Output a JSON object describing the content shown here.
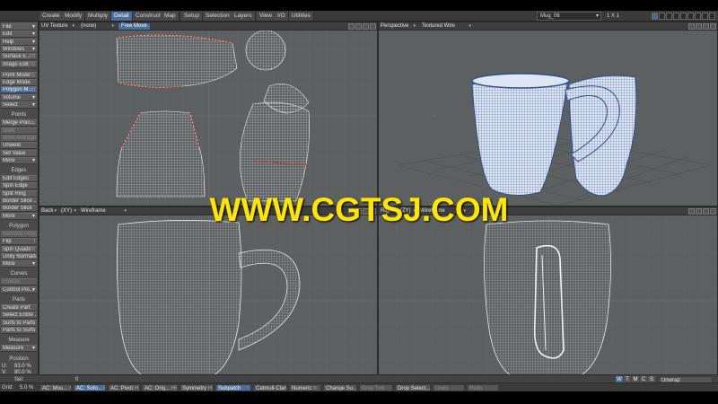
{
  "menu": {
    "tabs": [
      "Create",
      "Modify",
      "Multiply",
      "Detail",
      "Construct",
      "Map",
      "Setup",
      "Selection",
      "Layers",
      "View",
      "I/O",
      "Utilities"
    ],
    "active_tab": "Detail",
    "object_name": "Mug_06",
    "layer_label": "1 X 1"
  },
  "toolbar": {
    "top_buttons": [
      {
        "label": "File",
        "dropdown": true
      },
      {
        "label": "Edit",
        "dropdown": true
      },
      {
        "label": "Help",
        "dropdown": true
      },
      {
        "label": "Windows",
        "dropdown": true
      },
      {
        "label": "Surface E...",
        "key": "F5"
      },
      {
        "label": "Image Edit",
        "key": "F6"
      }
    ],
    "mode_buttons": [
      {
        "label": "Point Mode",
        "key": "^G"
      },
      {
        "label": "Edge Mode",
        "key": ""
      },
      {
        "label": "Polygon M...",
        "key": "^H",
        "selected": true
      },
      {
        "label": "Volume",
        "dropdown": true
      },
      {
        "label": "Select",
        "dropdown": true
      }
    ],
    "sections": [
      {
        "title": "Points",
        "items": [
          {
            "label": "Merge Poin...",
            "key": "m"
          },
          {
            "label": "Weld",
            "dim": true
          },
          {
            "label": "Weld Average",
            "dim": true
          },
          {
            "label": "Unweld"
          },
          {
            "label": "Set Value"
          },
          {
            "label": "More",
            "dropdown": true
          }
        ]
      },
      {
        "title": "Edges",
        "items": [
          {
            "label": "Edit Edges"
          },
          {
            "label": "Spin Edge"
          },
          {
            "label": "Split Ring"
          },
          {
            "label": "Border Slice ..."
          },
          {
            "label": "Border Slice"
          },
          {
            "label": "More",
            "dropdown": true
          }
        ]
      },
      {
        "title": "Polygon",
        "items": [
          {
            "label": "Remove Polyg...",
            "dim": true
          },
          {
            "label": "Flip",
            "key": "f"
          },
          {
            "label": "Spin Quads",
            "key": "^K"
          },
          {
            "label": "Unify Normals"
          },
          {
            "label": "More",
            "dropdown": true
          }
        ]
      },
      {
        "title": "Curves",
        "items": [
          {
            "label": "Freeze",
            "dim": true
          },
          {
            "label": "Control Poi...",
            "dropdown": true
          }
        ]
      },
      {
        "title": "Parts",
        "items": [
          {
            "label": "Create Part"
          },
          {
            "label": "Select Entire ..."
          },
          {
            "label": "Surfs to Parts"
          },
          {
            "label": "Parts to Surfs"
          }
        ]
      },
      {
        "title": "Measure",
        "items": [
          {
            "label": "Measure",
            "dropdown": true
          }
        ]
      }
    ],
    "position": {
      "title": "Position",
      "u_label": "U:",
      "u_value": "83.0 %",
      "v_label": "V:",
      "v_value": "80.0 %"
    }
  },
  "viewports": {
    "top_left": {
      "view": "UV Texture",
      "map": "(none)",
      "mode": "Free Move"
    },
    "top_right": {
      "view": "Perspective",
      "render": "Textured Wire"
    },
    "bottom_left": {
      "view": "Back",
      "axes": "(XY)",
      "render": "Wireframe"
    },
    "bottom_right": {
      "view": "Right",
      "axes": "(ZY)",
      "render": "Wireframe"
    }
  },
  "watermark": "WWW.CGTSJ.COM",
  "status": {
    "sel_label": "Sel:",
    "sel_value": "0",
    "wtmcs": [
      "W",
      "T",
      "M",
      "C",
      "S"
    ],
    "wtmcs_active": "W",
    "unwrap": "Unwrap",
    "grid_label": "Grid:",
    "grid_value": "5.0 %",
    "bottom_buttons": [
      {
        "label": "AC: Mou...",
        "key": "HF1"
      },
      {
        "label": "AC: Sofo...",
        "key": "HF2",
        "on": true
      },
      {
        "label": "AC: Pivot",
        "key": "HF3"
      },
      {
        "label": "AC: Orig...",
        "key": "HF4"
      },
      {
        "label": "Symmetry",
        "key": "HY"
      },
      {
        "label": "Subpatch",
        "on": true
      },
      {
        "label": "Catmull-Clark"
      },
      {
        "label": "Numeric",
        "key": "n"
      },
      {
        "label": "Change Su...",
        "key": "q"
      },
      {
        "label": "Drop Tool",
        "dim": true
      },
      {
        "label": "Drop Select...",
        "key": "/"
      },
      {
        "label": "Undo",
        "dim": true
      },
      {
        "label": "Redo",
        "dim": true
      }
    ]
  },
  "colors": {
    "accent": "#4a6e9a",
    "wire": "#d8d8d8",
    "mug_blue": "#3f5f9e",
    "seam_red": "#d02020",
    "watermark": "#ffe600"
  }
}
